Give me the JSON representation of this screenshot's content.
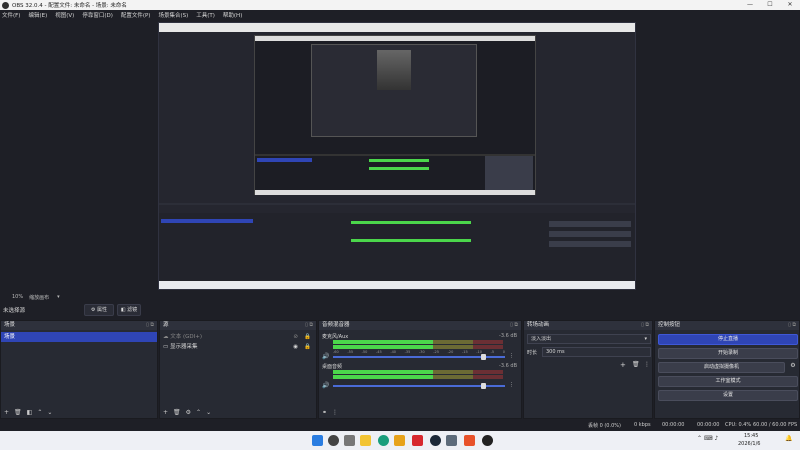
{
  "titlebar": {
    "title": "OBS 32.0.4 - 配置文件: 未命名 - 场景: 未命名",
    "minimize": "—",
    "maximize": "☐",
    "close": "✕"
  },
  "menu": [
    "文件(F)",
    "编辑(E)",
    "视图(V)",
    "停靠窗口(D)",
    "配置文件(P)",
    "场景集合(S)",
    "工具(T)",
    "帮助(H)"
  ],
  "preview_toolbar": {
    "zoom": "10%",
    "mode": "缩放画布"
  },
  "scenebar": {
    "label": "未选择源",
    "properties": "属性",
    "filters": "滤镜"
  },
  "scenes": {
    "title": "场景",
    "items": [
      "场景"
    ]
  },
  "sources": {
    "title": "源",
    "items": [
      {
        "icon": "cloud-icon",
        "label": "文本 (GDI+)"
      },
      {
        "icon": "monitor-icon",
        "label": "显示器采集"
      }
    ]
  },
  "mixer": {
    "title": "音频混音器",
    "tracks": [
      {
        "name": "麦克风/Aux",
        "db": "-3.6 dB",
        "fader": 0.78
      },
      {
        "name": "桌面音频",
        "db": "-3.6 dB",
        "fader": 0.78
      }
    ],
    "ticks": [
      "-60",
      "-55",
      "-50",
      "-45",
      "-40",
      "-35",
      "-30",
      "-25",
      "-20",
      "-15",
      "-10",
      "-5",
      "0"
    ]
  },
  "transitions": {
    "title": "转场动画",
    "type": "淡入淡出",
    "duration_label": "时长",
    "duration": "300 ms"
  },
  "controls": {
    "title": "控制按钮",
    "buttons": [
      "停止直播",
      "开始录制",
      "启动虚拟摄像机",
      "工作室模式",
      "设置"
    ]
  },
  "status": {
    "frames": "丢帧 0 (0.0%)",
    "bitrate": "0 kbps",
    "rec_time": "00:00:00",
    "stream_time": "00:00:00",
    "cpu": "CPU: 0.4%",
    "fps": "60.00 / 60.00 FPS"
  },
  "taskbar": {
    "time": "15:45",
    "date": "2026/1/6"
  },
  "colors": {
    "accent": "#2f45b5",
    "meter_green": "#4bd64b",
    "meter_yellow": "#d2c94a",
    "meter_red": "#d24a4a"
  }
}
